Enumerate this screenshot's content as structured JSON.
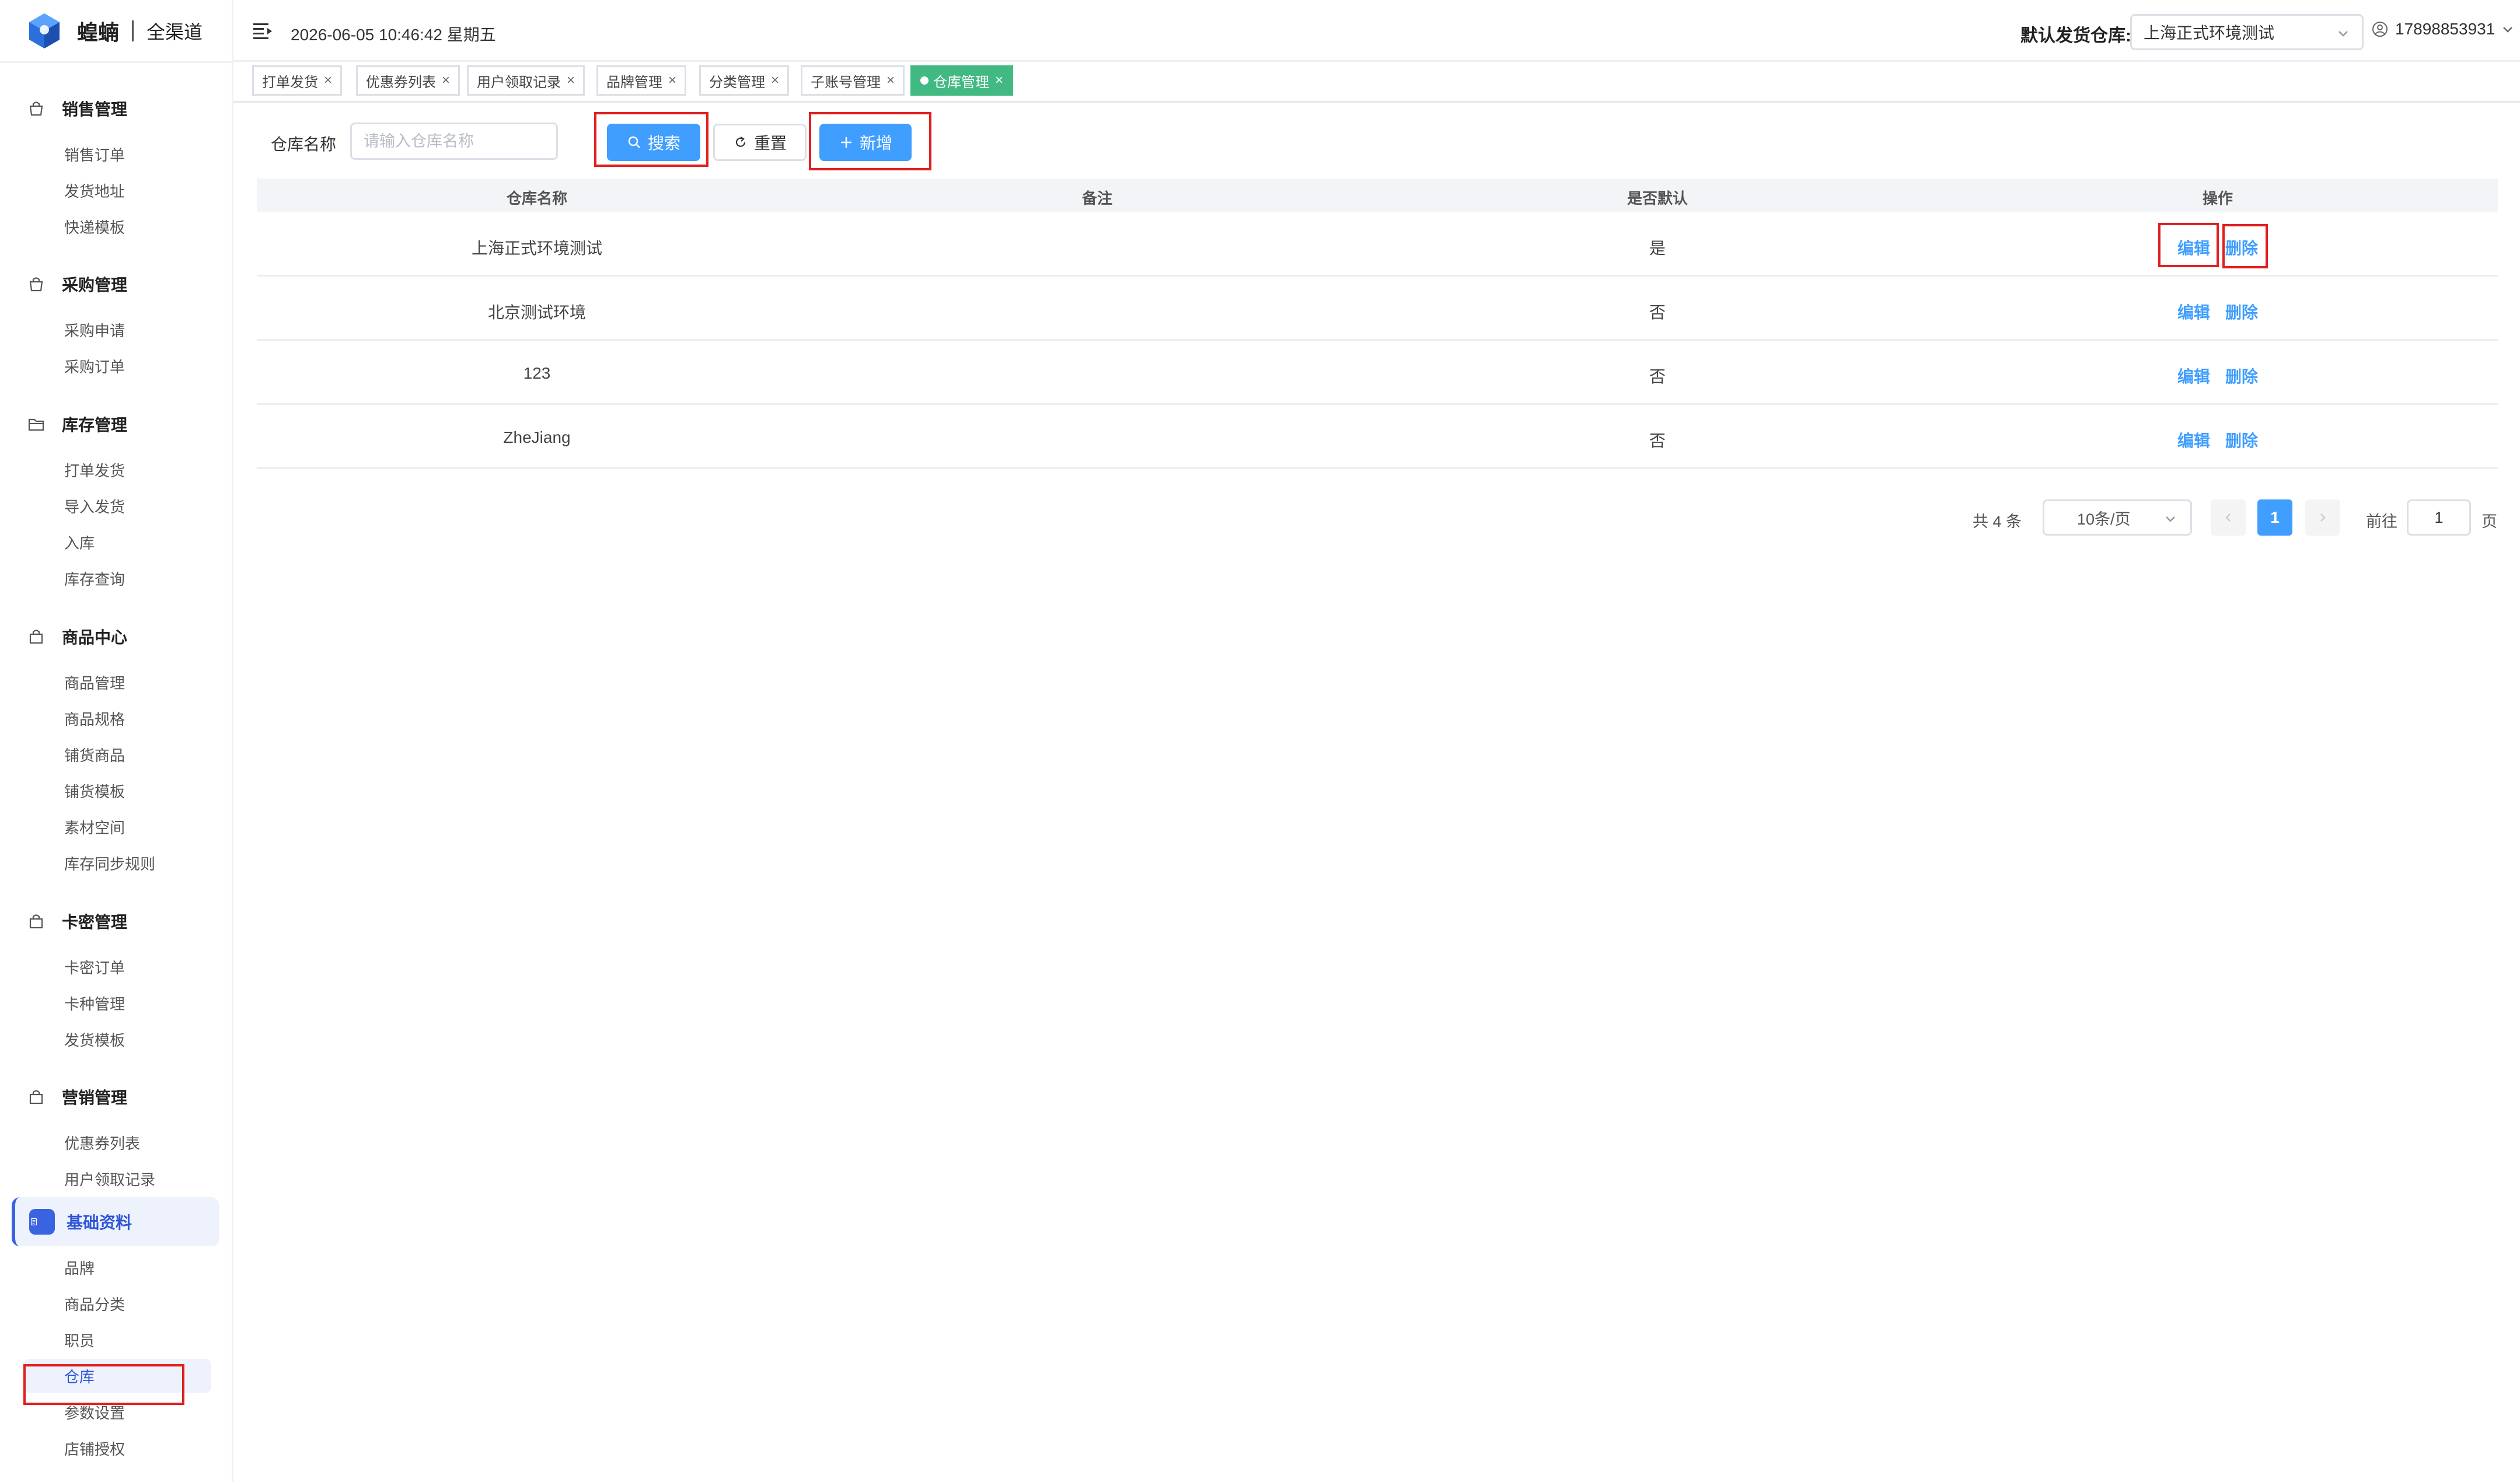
{
  "app": {
    "name": "蝗蝻",
    "subtitle": "全渠道"
  },
  "sidebar": {
    "groups": [
      {
        "title": "销售管理",
        "icon": "cart-icon",
        "items": [
          "销售订单",
          "发货地址",
          "快递模板"
        ]
      },
      {
        "title": "采购管理",
        "icon": "cart-icon",
        "items": [
          "采购申请",
          "采购订单"
        ]
      },
      {
        "title": "库存管理",
        "icon": "folder-icon",
        "items": [
          "打单发货",
          "导入发货",
          "入库",
          "库存查询"
        ]
      },
      {
        "title": "商品中心",
        "icon": "bag-icon",
        "items": [
          "商品管理",
          "商品规格",
          "铺货商品",
          "铺货模板",
          "素材空间",
          "库存同步规则"
        ]
      },
      {
        "title": "卡密管理",
        "icon": "bag-icon",
        "items": [
          "卡密订单",
          "卡种管理",
          "发货模板"
        ]
      },
      {
        "title": "营销管理",
        "icon": "bag-icon",
        "items": [
          "优惠券列表",
          "用户领取记录"
        ]
      },
      {
        "title": "基础资料",
        "icon": "document-icon",
        "items": [
          "品牌",
          "商品分类",
          "职员",
          "仓库",
          "参数设置",
          "店铺授权"
        ]
      }
    ],
    "active_group": "基础资料",
    "selected_item": "仓库"
  },
  "header": {
    "datetime": "2026-06-05 10:46:42 星期五",
    "default_warehouse_label": "默认发货仓库:",
    "default_warehouse_value": "上海正式环境测试",
    "user": "17898853931"
  },
  "tags": [
    {
      "label": "打单发货",
      "active": false
    },
    {
      "label": "优惠券列表",
      "active": false
    },
    {
      "label": "用户领取记录",
      "active": false
    },
    {
      "label": "品牌管理",
      "active": false
    },
    {
      "label": "分类管理",
      "active": false
    },
    {
      "label": "子账号管理",
      "active": false
    },
    {
      "label": "仓库管理",
      "active": true
    }
  ],
  "search": {
    "label": "仓库名称",
    "placeholder": "请输入仓库名称",
    "search_button": "搜索",
    "reset_button": "重置",
    "add_button": "新增"
  },
  "table": {
    "columns": [
      "仓库名称",
      "备注",
      "是否默认",
      "操作"
    ],
    "rows": [
      {
        "name": "上海正式环境测试",
        "remark": "",
        "is_default": "是",
        "edit": "编辑",
        "delete": "删除"
      },
      {
        "name": "北京测试环境",
        "remark": "",
        "is_default": "否",
        "edit": "编辑",
        "delete": "删除"
      },
      {
        "name": "123",
        "remark": "",
        "is_default": "否",
        "edit": "编辑",
        "delete": "删除"
      },
      {
        "name": "ZheJiang",
        "remark": "",
        "is_default": "否",
        "edit": "编辑",
        "delete": "删除"
      }
    ]
  },
  "pagination": {
    "total_text": "共 4 条",
    "page_size": "10条/页",
    "current_page": "1",
    "goto_label": "前往",
    "goto_value": "1",
    "page_suffix": "页"
  },
  "colors": {
    "primary": "#409eff",
    "active_tag": "#42b983",
    "highlight_box": "#e02020",
    "sidebar_active": "#3a63e0"
  }
}
